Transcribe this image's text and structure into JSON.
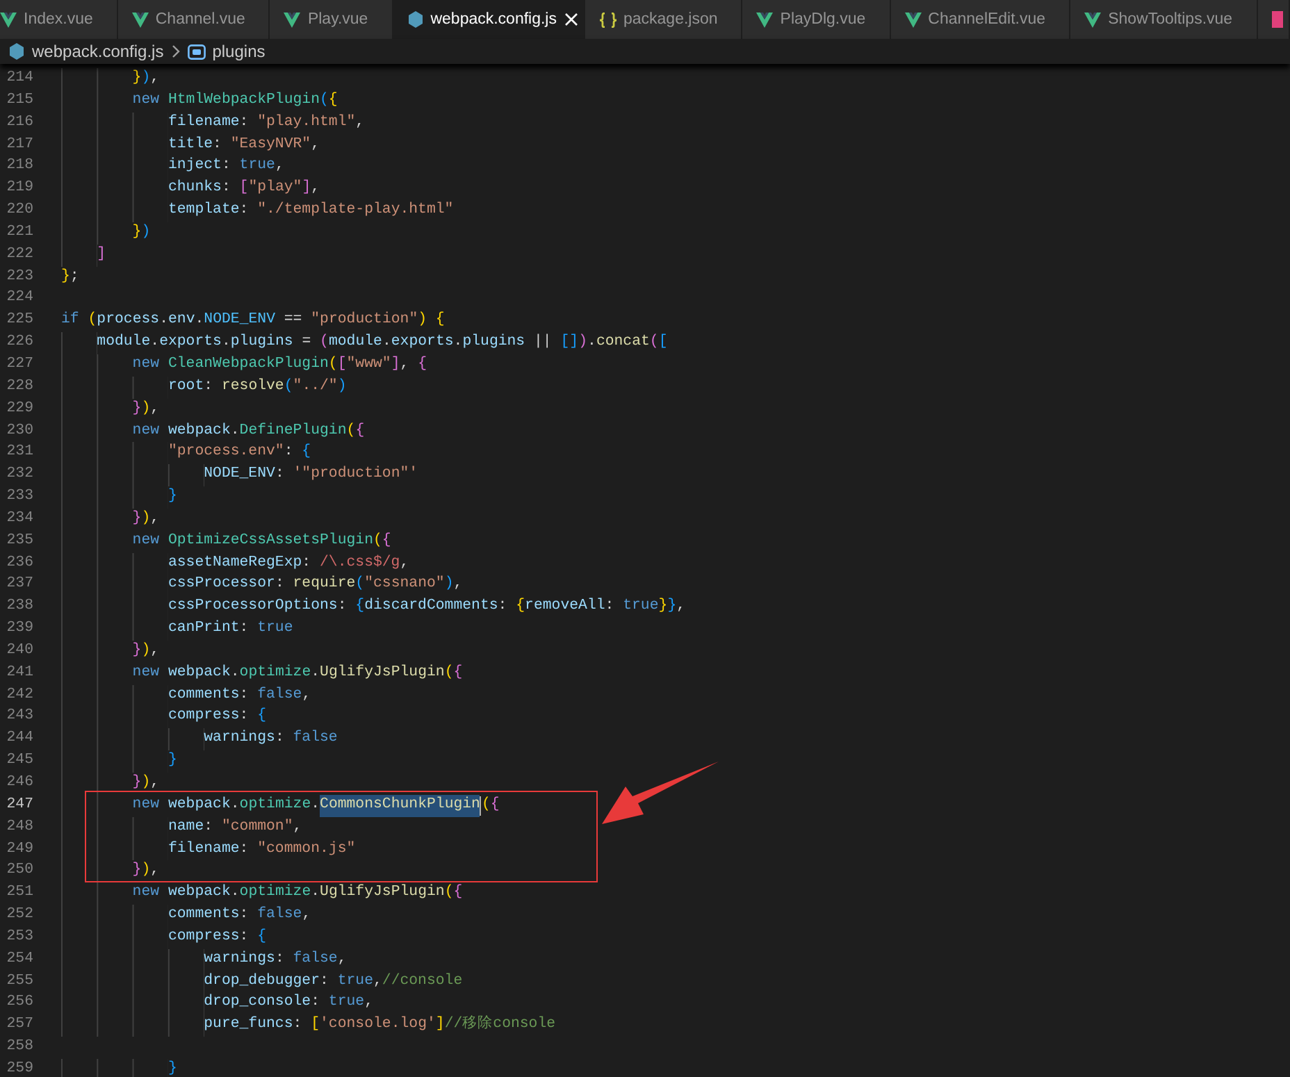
{
  "tabs": [
    {
      "label": "Index.vue",
      "kind": "vue",
      "selected": false
    },
    {
      "label": "Channel.vue",
      "kind": "vue",
      "selected": false
    },
    {
      "label": "Play.vue",
      "kind": "vue",
      "selected": false
    },
    {
      "label": "webpack.config.js",
      "kind": "js",
      "selected": true
    },
    {
      "label": "package.json",
      "kind": "json",
      "selected": false
    },
    {
      "label": "PlayDlg.vue",
      "kind": "vue",
      "selected": false
    },
    {
      "label": "ChannelEdit.vue",
      "kind": "vue",
      "selected": false
    },
    {
      "label": "ShowTooltips.vue",
      "kind": "vue",
      "selected": false
    },
    {
      "kind": "other",
      "selected": false
    }
  ],
  "breadcrumb": [
    {
      "label": "webpack.config.js",
      "kind": "js"
    },
    {
      "label": "plugins",
      "kind": "symbol"
    }
  ],
  "editor": {
    "lines": [
      {
        "number": "214",
        "current": false,
        "boxed": false,
        "tokens": [
          {
            "kind": "b1",
            "text": "        }"
          },
          {
            "kind": "b3",
            "text": ")"
          },
          {
            "kind": "plain",
            "text": ","
          }
        ]
      },
      {
        "number": "215",
        "current": false,
        "boxed": false,
        "tokens": [
          {
            "kind": "keyword",
            "text": "        new "
          },
          {
            "kind": "type",
            "text": "HtmlWebpackPlugin"
          },
          {
            "kind": "b3",
            "text": "("
          },
          {
            "kind": "b1",
            "text": "{"
          }
        ]
      },
      {
        "number": "216",
        "current": false,
        "boxed": false,
        "tokens": [
          {
            "kind": "prop",
            "text": "            filename"
          },
          {
            "kind": "plain",
            "text": ": "
          },
          {
            "kind": "string",
            "text": "\"play.html\""
          },
          {
            "kind": "plain",
            "text": ","
          }
        ]
      },
      {
        "number": "217",
        "current": false,
        "boxed": false,
        "tokens": [
          {
            "kind": "prop",
            "text": "            title"
          },
          {
            "kind": "plain",
            "text": ": "
          },
          {
            "kind": "string",
            "text": "\"EasyNVR\""
          },
          {
            "kind": "plain",
            "text": ","
          }
        ]
      },
      {
        "number": "218",
        "current": false,
        "boxed": false,
        "tokens": [
          {
            "kind": "prop",
            "text": "            inject"
          },
          {
            "kind": "plain",
            "text": ": "
          },
          {
            "kind": "literal",
            "text": "true"
          },
          {
            "kind": "plain",
            "text": ","
          }
        ]
      },
      {
        "number": "219",
        "current": false,
        "boxed": false,
        "tokens": [
          {
            "kind": "prop",
            "text": "            chunks"
          },
          {
            "kind": "plain",
            "text": ": "
          },
          {
            "kind": "b2",
            "text": "["
          },
          {
            "kind": "string",
            "text": "\"play\""
          },
          {
            "kind": "b2",
            "text": "]"
          },
          {
            "kind": "plain",
            "text": ","
          }
        ]
      },
      {
        "number": "220",
        "current": false,
        "boxed": false,
        "tokens": [
          {
            "kind": "prop",
            "text": "            template"
          },
          {
            "kind": "plain",
            "text": ": "
          },
          {
            "kind": "string",
            "text": "\"./template-play.html\""
          }
        ]
      },
      {
        "number": "221",
        "current": false,
        "boxed": false,
        "tokens": [
          {
            "kind": "b1",
            "text": "        }"
          },
          {
            "kind": "b3",
            "text": ")"
          }
        ]
      },
      {
        "number": "222",
        "current": false,
        "boxed": false,
        "tokens": [
          {
            "kind": "b2",
            "text": "    ]"
          }
        ]
      },
      {
        "number": "223",
        "current": false,
        "boxed": false,
        "tokens": [
          {
            "kind": "b1",
            "text": "}"
          },
          {
            "kind": "plain",
            "text": ";"
          }
        ]
      },
      {
        "number": "224",
        "current": false,
        "boxed": false
      },
      {
        "number": "225",
        "current": false,
        "boxed": false,
        "tokens": [
          {
            "kind": "keyword",
            "text": "if "
          },
          {
            "kind": "b1",
            "text": "("
          },
          {
            "kind": "prop",
            "text": "process"
          },
          {
            "kind": "plain",
            "text": "."
          },
          {
            "kind": "prop",
            "text": "env"
          },
          {
            "kind": "plain",
            "text": "."
          },
          {
            "kind": "const",
            "text": "NODE_ENV"
          },
          {
            "kind": "plain",
            "text": " == "
          },
          {
            "kind": "string",
            "text": "\"production\""
          },
          {
            "kind": "b1",
            "text": ") {"
          }
        ]
      },
      {
        "number": "226",
        "current": false,
        "boxed": false,
        "tokens": [
          {
            "kind": "prop",
            "text": "    module"
          },
          {
            "kind": "plain",
            "text": "."
          },
          {
            "kind": "prop",
            "text": "exports"
          },
          {
            "kind": "plain",
            "text": "."
          },
          {
            "kind": "prop",
            "text": "plugins"
          },
          {
            "kind": "plain",
            "text": " = "
          },
          {
            "kind": "b2",
            "text": "("
          },
          {
            "kind": "prop",
            "text": "module"
          },
          {
            "kind": "plain",
            "text": "."
          },
          {
            "kind": "prop",
            "text": "exports"
          },
          {
            "kind": "plain",
            "text": "."
          },
          {
            "kind": "prop",
            "text": "plugins"
          },
          {
            "kind": "plain",
            "text": " || "
          },
          {
            "kind": "b3",
            "text": "[]"
          },
          {
            "kind": "b2",
            "text": ")"
          },
          {
            "kind": "plain",
            "text": "."
          },
          {
            "kind": "function",
            "text": "concat"
          },
          {
            "kind": "b2",
            "text": "("
          },
          {
            "kind": "b3",
            "text": "["
          }
        ]
      },
      {
        "number": "227",
        "current": false,
        "boxed": false,
        "tokens": [
          {
            "kind": "keyword",
            "text": "        new "
          },
          {
            "kind": "type",
            "text": "CleanWebpackPlugin"
          },
          {
            "kind": "b1",
            "text": "("
          },
          {
            "kind": "b2",
            "text": "["
          },
          {
            "kind": "string",
            "text": "\"www\""
          },
          {
            "kind": "b2",
            "text": "]"
          },
          {
            "kind": "plain",
            "text": ", "
          },
          {
            "kind": "b2",
            "text": "{"
          }
        ]
      },
      {
        "number": "228",
        "current": false,
        "boxed": false,
        "tokens": [
          {
            "kind": "prop",
            "text": "            root"
          },
          {
            "kind": "plain",
            "text": ": "
          },
          {
            "kind": "function",
            "text": "resolve"
          },
          {
            "kind": "b3",
            "text": "("
          },
          {
            "kind": "string",
            "text": "\"../\""
          },
          {
            "kind": "b3",
            "text": ")"
          }
        ]
      },
      {
        "number": "229",
        "current": false,
        "boxed": false,
        "tokens": [
          {
            "kind": "b2",
            "text": "        }"
          },
          {
            "kind": "b1",
            "text": ")"
          },
          {
            "kind": "plain",
            "text": ","
          }
        ]
      },
      {
        "number": "230",
        "current": false,
        "boxed": false,
        "tokens": [
          {
            "kind": "keyword",
            "text": "        new "
          },
          {
            "kind": "prop",
            "text": "webpack"
          },
          {
            "kind": "plain",
            "text": "."
          },
          {
            "kind": "type",
            "text": "DefinePlugin"
          },
          {
            "kind": "b1",
            "text": "("
          },
          {
            "kind": "b2",
            "text": "{"
          }
        ]
      },
      {
        "number": "231",
        "current": false,
        "boxed": false,
        "tokens": [
          {
            "kind": "string",
            "text": "            \"process.env\""
          },
          {
            "kind": "plain",
            "text": ": "
          },
          {
            "kind": "b3",
            "text": "{"
          }
        ]
      },
      {
        "number": "232",
        "current": false,
        "boxed": false,
        "tokens": [
          {
            "kind": "prop",
            "text": "                NODE_ENV"
          },
          {
            "kind": "plain",
            "text": ": "
          },
          {
            "kind": "string",
            "text": "'\"production\"'"
          }
        ]
      },
      {
        "number": "233",
        "current": false,
        "boxed": false,
        "tokens": [
          {
            "kind": "b3",
            "text": "            }"
          }
        ]
      },
      {
        "number": "234",
        "current": false,
        "boxed": false,
        "tokens": [
          {
            "kind": "b2",
            "text": "        }"
          },
          {
            "kind": "b1",
            "text": ")"
          },
          {
            "kind": "plain",
            "text": ","
          }
        ]
      },
      {
        "number": "235",
        "current": false,
        "boxed": false,
        "tokens": [
          {
            "kind": "keyword",
            "text": "        new "
          },
          {
            "kind": "type",
            "text": "OptimizeCssAssetsPlugin"
          },
          {
            "kind": "b1",
            "text": "("
          },
          {
            "kind": "b2",
            "text": "{"
          }
        ]
      },
      {
        "number": "236",
        "current": false,
        "boxed": false,
        "tokens": [
          {
            "kind": "prop",
            "text": "            assetNameRegExp"
          },
          {
            "kind": "plain",
            "text": ": "
          },
          {
            "kind": "regex",
            "text": "/\\.css$/g"
          },
          {
            "kind": "plain",
            "text": ","
          }
        ]
      },
      {
        "number": "237",
        "current": false,
        "boxed": false,
        "tokens": [
          {
            "kind": "prop",
            "text": "            cssProcessor"
          },
          {
            "kind": "plain",
            "text": ": "
          },
          {
            "kind": "function",
            "text": "require"
          },
          {
            "kind": "b3",
            "text": "("
          },
          {
            "kind": "string",
            "text": "\"cssnano\""
          },
          {
            "kind": "b3",
            "text": ")"
          },
          {
            "kind": "plain",
            "text": ","
          }
        ]
      },
      {
        "number": "238",
        "current": false,
        "boxed": false,
        "tokens": [
          {
            "kind": "prop",
            "text": "            cssProcessorOptions"
          },
          {
            "kind": "plain",
            "text": ": "
          },
          {
            "kind": "b3",
            "text": "{"
          },
          {
            "kind": "prop",
            "text": "discardComments"
          },
          {
            "kind": "plain",
            "text": ": "
          },
          {
            "kind": "b1",
            "text": "{"
          },
          {
            "kind": "prop",
            "text": "removeAll"
          },
          {
            "kind": "plain",
            "text": ": "
          },
          {
            "kind": "literal",
            "text": "true"
          },
          {
            "kind": "b1",
            "text": "}"
          },
          {
            "kind": "b3",
            "text": "}"
          },
          {
            "kind": "plain",
            "text": ","
          }
        ]
      },
      {
        "number": "239",
        "current": false,
        "boxed": false,
        "tokens": [
          {
            "kind": "prop",
            "text": "            canPrint"
          },
          {
            "kind": "plain",
            "text": ": "
          },
          {
            "kind": "literal",
            "text": "true"
          }
        ]
      },
      {
        "number": "240",
        "current": false,
        "boxed": false,
        "tokens": [
          {
            "kind": "b2",
            "text": "        }"
          },
          {
            "kind": "b1",
            "text": ")"
          },
          {
            "kind": "plain",
            "text": ","
          }
        ]
      },
      {
        "number": "241",
        "current": false,
        "boxed": false,
        "tokens": [
          {
            "kind": "keyword",
            "text": "        new "
          },
          {
            "kind": "prop",
            "text": "webpack"
          },
          {
            "kind": "plain",
            "text": "."
          },
          {
            "kind": "type",
            "text": "optimize"
          },
          {
            "kind": "plain",
            "text": "."
          },
          {
            "kind": "function",
            "text": "UglifyJsPlugin"
          },
          {
            "kind": "b1",
            "text": "("
          },
          {
            "kind": "b2",
            "text": "{"
          }
        ]
      },
      {
        "number": "242",
        "current": false,
        "boxed": false,
        "tokens": [
          {
            "kind": "prop",
            "text": "            comments"
          },
          {
            "kind": "plain",
            "text": ": "
          },
          {
            "kind": "literal",
            "text": "false"
          },
          {
            "kind": "plain",
            "text": ","
          }
        ]
      },
      {
        "number": "243",
        "current": false,
        "boxed": false,
        "tokens": [
          {
            "kind": "prop",
            "text": "            compress"
          },
          {
            "kind": "plain",
            "text": ": "
          },
          {
            "kind": "b3",
            "text": "{"
          }
        ]
      },
      {
        "number": "244",
        "current": false,
        "boxed": false,
        "tokens": [
          {
            "kind": "prop",
            "text": "                warnings"
          },
          {
            "kind": "plain",
            "text": ": "
          },
          {
            "kind": "literal",
            "text": "false"
          }
        ]
      },
      {
        "number": "245",
        "current": false,
        "boxed": false,
        "tokens": [
          {
            "kind": "b3",
            "text": "            }"
          }
        ]
      },
      {
        "number": "246",
        "current": false,
        "boxed": false,
        "tokens": [
          {
            "kind": "b2",
            "text": "        }"
          },
          {
            "kind": "b1",
            "text": ")"
          },
          {
            "kind": "plain",
            "text": ","
          }
        ]
      },
      {
        "number": "247",
        "current": true,
        "boxed": true,
        "tokens": [
          {
            "kind": "keyword",
            "text": "        new "
          },
          {
            "kind": "prop",
            "text": "webpack"
          },
          {
            "kind": "plain",
            "text": "."
          },
          {
            "kind": "type",
            "text": "optimize"
          },
          {
            "kind": "plain",
            "text": "."
          },
          {
            "kind": "selection",
            "text": "CommonsChunkPlugin"
          },
          {
            "kind": "b1",
            "text": "("
          },
          {
            "kind": "b2",
            "text": "{"
          }
        ]
      },
      {
        "number": "248",
        "current": false,
        "boxed": true,
        "tokens": [
          {
            "kind": "prop",
            "text": "            name"
          },
          {
            "kind": "plain",
            "text": ": "
          },
          {
            "kind": "string",
            "text": "\"common\""
          },
          {
            "kind": "plain",
            "text": ","
          }
        ]
      },
      {
        "number": "249",
        "current": false,
        "boxed": true,
        "tokens": [
          {
            "kind": "prop",
            "text": "            filename"
          },
          {
            "kind": "plain",
            "text": ": "
          },
          {
            "kind": "string",
            "text": "\"common.js\""
          }
        ]
      },
      {
        "number": "250",
        "current": false,
        "boxed": true,
        "tokens": [
          {
            "kind": "b2",
            "text": "        }"
          },
          {
            "kind": "b1",
            "text": ")"
          },
          {
            "kind": "plain",
            "text": ","
          }
        ]
      },
      {
        "number": "251",
        "current": false,
        "boxed": false,
        "tokens": [
          {
            "kind": "keyword",
            "text": "        new "
          },
          {
            "kind": "prop",
            "text": "webpack"
          },
          {
            "kind": "plain",
            "text": "."
          },
          {
            "kind": "type",
            "text": "optimize"
          },
          {
            "kind": "plain",
            "text": "."
          },
          {
            "kind": "function",
            "text": "UglifyJsPlugin"
          },
          {
            "kind": "b1",
            "text": "("
          },
          {
            "kind": "b2",
            "text": "{"
          }
        ]
      },
      {
        "number": "252",
        "current": false,
        "boxed": false,
        "tokens": [
          {
            "kind": "prop",
            "text": "            comments"
          },
          {
            "kind": "plain",
            "text": ": "
          },
          {
            "kind": "literal",
            "text": "false"
          },
          {
            "kind": "plain",
            "text": ","
          }
        ]
      },
      {
        "number": "253",
        "current": false,
        "boxed": false,
        "tokens": [
          {
            "kind": "prop",
            "text": "            compress"
          },
          {
            "kind": "plain",
            "text": ": "
          },
          {
            "kind": "b3",
            "text": "{"
          }
        ]
      },
      {
        "number": "254",
        "current": false,
        "boxed": false,
        "tokens": [
          {
            "kind": "prop",
            "text": "                warnings"
          },
          {
            "kind": "plain",
            "text": ": "
          },
          {
            "kind": "literal",
            "text": "false"
          },
          {
            "kind": "plain",
            "text": ","
          }
        ]
      },
      {
        "number": "255",
        "current": false,
        "boxed": false,
        "tokens": [
          {
            "kind": "prop",
            "text": "                drop_debugger"
          },
          {
            "kind": "plain",
            "text": ": "
          },
          {
            "kind": "literal",
            "text": "true"
          },
          {
            "kind": "plain",
            "text": ","
          },
          {
            "kind": "comment",
            "text": "//console"
          }
        ]
      },
      {
        "number": "256",
        "current": false,
        "boxed": false,
        "tokens": [
          {
            "kind": "prop",
            "text": "                drop_console"
          },
          {
            "kind": "plain",
            "text": ": "
          },
          {
            "kind": "literal",
            "text": "true"
          },
          {
            "kind": "plain",
            "text": ","
          }
        ]
      },
      {
        "number": "257",
        "current": false,
        "boxed": false,
        "tokens": [
          {
            "kind": "prop",
            "text": "                pure_funcs"
          },
          {
            "kind": "plain",
            "text": ": "
          },
          {
            "kind": "b1",
            "text": "["
          },
          {
            "kind": "string",
            "text": "'console.log'"
          },
          {
            "kind": "b1",
            "text": "]"
          },
          {
            "kind": "comment",
            "text": "//移除console"
          }
        ]
      },
      {
        "number": "258",
        "current": false,
        "boxed": false
      },
      {
        "number": "259",
        "current": false,
        "boxed": false,
        "tokens": [
          {
            "kind": "b3",
            "text": "            }"
          }
        ]
      }
    ]
  }
}
